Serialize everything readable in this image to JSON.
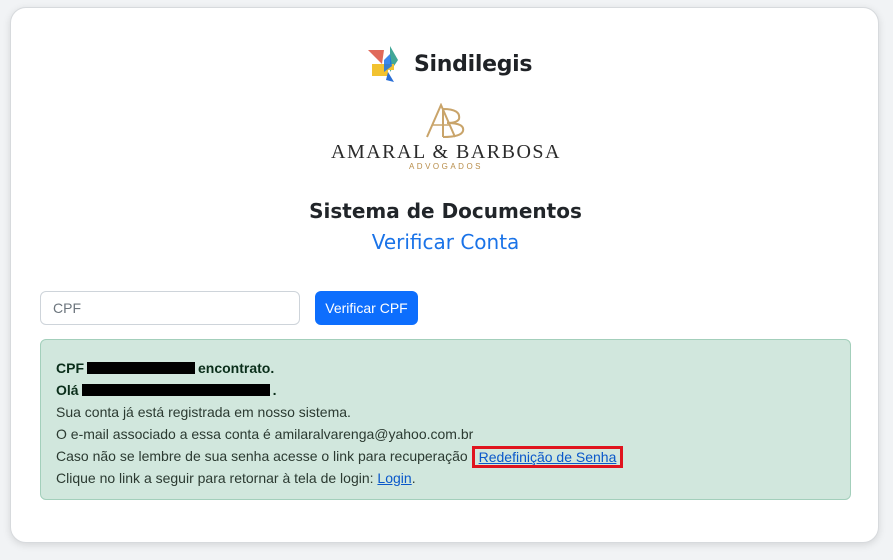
{
  "brand": {
    "name": "Sindilegis",
    "colors": {
      "red": "#e0695a",
      "yellow": "#f2c230",
      "blue": "#1a73e8",
      "teal": "#2e9d8c"
    }
  },
  "firm": {
    "monogram": "AB",
    "name": "AMARAL & BARBOSA",
    "subtitle": "ADVOGADOS",
    "gold": "#c9a46a"
  },
  "headings": {
    "system_title": "Sistema de Documentos",
    "verify_title": "Verificar Conta"
  },
  "form": {
    "cpf_placeholder": "CPF",
    "cpf_value": "",
    "verify_button": "Verificar CPF"
  },
  "alert": {
    "line1_prefix": "CPF",
    "line1_suffix": "encontrato.",
    "line2_prefix": "Olá",
    "line2_suffix": ".",
    "line3": "Sua conta já está registrada em nosso sistema.",
    "line4": "O e-mail associado a essa conta é amilaralvarenga@yahoo.com.br",
    "line5_text": "Caso não se lembre de sua senha acesse o link para recuperação",
    "line5_link": "Redefinição de Senha",
    "line6_text": "Clique no link a seguir para retornar à tela de login:",
    "line6_link": "Login",
    "line6_end": "."
  },
  "accent": {
    "primary": "#0d6efd",
    "success_bg": "#d1e7dd",
    "highlight": "#e0141e"
  }
}
